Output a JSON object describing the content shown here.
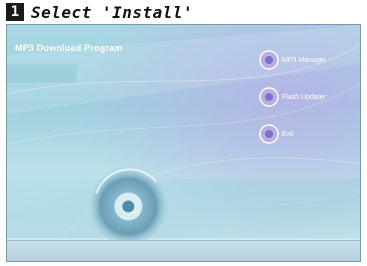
{
  "step": {
    "number": "1",
    "instruction": "Select 'Install'"
  },
  "window": {
    "title": "MP3 Download Program"
  },
  "menu": {
    "items": [
      {
        "label": "MP3 Manager",
        "icon": "install-icon"
      },
      {
        "label": "Flash Updater",
        "icon": "update-icon"
      },
      {
        "label": "Exit",
        "icon": "exit-icon"
      }
    ]
  },
  "colors": {
    "accent": "#8a7fd0",
    "background": "#a9d8e4"
  }
}
